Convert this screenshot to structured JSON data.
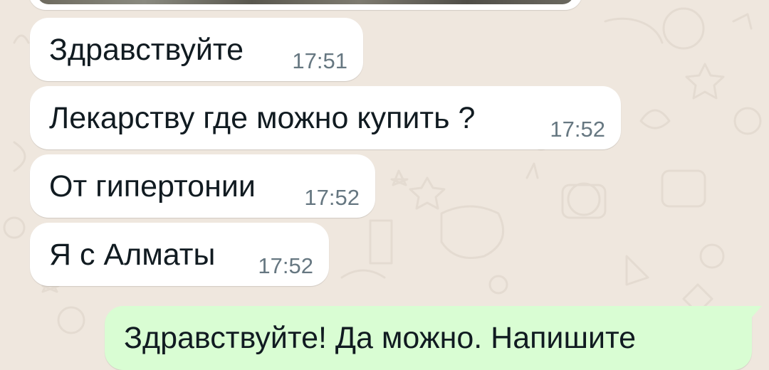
{
  "chat": {
    "incoming": [
      {
        "text": "Здравствуйте",
        "time": "17:51"
      },
      {
        "text": "Лекарству где можно купить ?",
        "time": "17:52"
      },
      {
        "text": "От гипертонии",
        "time": "17:52"
      },
      {
        "text": "Я с Алматы",
        "time": "17:52"
      }
    ],
    "outgoing": [
      {
        "text": "Здравствуйте! Да можно. Напишите"
      }
    ]
  },
  "colors": {
    "background": "#efe7de",
    "incoming_bubble": "#ffffff",
    "outgoing_bubble": "#d9fdd3",
    "message_text": "#111b21",
    "timestamp_text": "#667781"
  }
}
